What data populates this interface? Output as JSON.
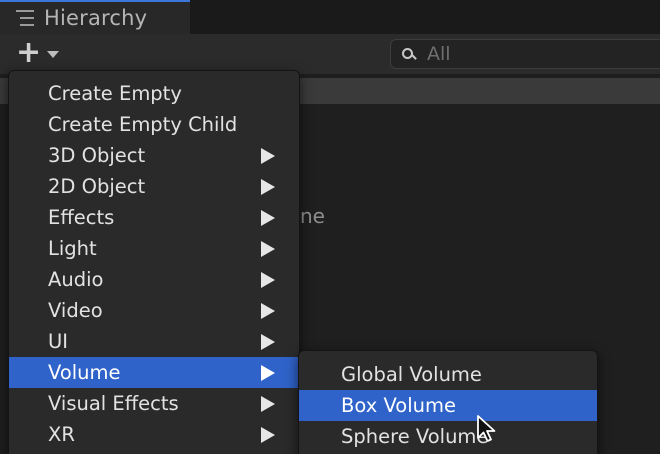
{
  "window": {
    "tab_title": "Hierarchy",
    "tab_icon": "hierarchy-list-icon"
  },
  "toolbar": {
    "add_icon": "plus-icon",
    "dropdown_icon": "caret-down-icon",
    "search_placeholder": "All",
    "search_value": ""
  },
  "background": {
    "partial_text": "ne"
  },
  "menu": {
    "items": [
      {
        "label": "Create Empty",
        "has_submenu": false
      },
      {
        "label": "Create Empty Child",
        "has_submenu": false
      },
      {
        "label": "3D Object",
        "has_submenu": true
      },
      {
        "label": "2D Object",
        "has_submenu": true
      },
      {
        "label": "Effects",
        "has_submenu": true
      },
      {
        "label": "Light",
        "has_submenu": true
      },
      {
        "label": "Audio",
        "has_submenu": true
      },
      {
        "label": "Video",
        "has_submenu": true
      },
      {
        "label": "UI",
        "has_submenu": true
      },
      {
        "label": "Volume",
        "has_submenu": true,
        "active": true
      },
      {
        "label": "Visual Effects",
        "has_submenu": true
      },
      {
        "label": "XR",
        "has_submenu": true
      }
    ]
  },
  "submenu": {
    "parent": "Volume",
    "items": [
      {
        "label": "Global Volume"
      },
      {
        "label": "Box Volume",
        "active": true
      },
      {
        "label": "Sphere Volume"
      }
    ]
  },
  "colors": {
    "accent": "#2f63c9",
    "menu_bg": "#2a2a2a",
    "text": "#e2e2e2"
  }
}
